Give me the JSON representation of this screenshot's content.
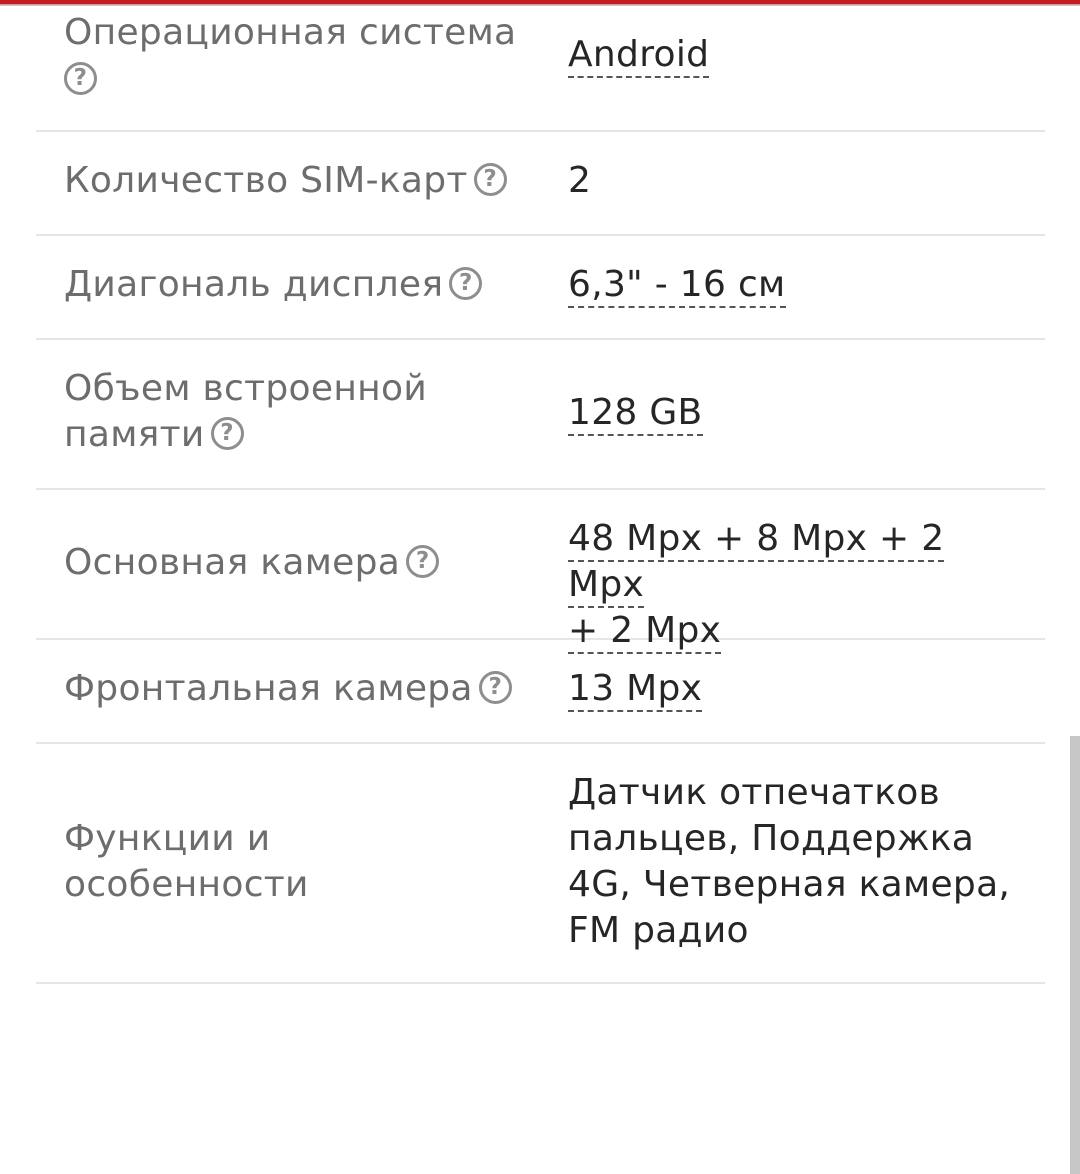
{
  "specs": [
    {
      "label": "Операционная система",
      "value": "Android",
      "help": "?"
    },
    {
      "label": "Количество SIM-карт",
      "value": "2",
      "help": "?"
    },
    {
      "label": "Диагональ дисплея",
      "value": "6,3\" - 16 см",
      "help": "?"
    },
    {
      "label_line1": "Объем встроенной",
      "label_line2": "памяти",
      "value": "128 GB",
      "help": "?"
    },
    {
      "label": "Основная камера",
      "value_line1": "48 Mpx + 8 Mpx + 2 Mpx",
      "value_line2": "+ 2 Mpx",
      "help": "?"
    },
    {
      "label": "Фронтальная камера",
      "value": "13 Mpx",
      "help": "?"
    },
    {
      "label_line1": "Функции и",
      "label_line2": "особенности",
      "value_lines": [
        "Датчик отпечатков",
        "пальцев, Поддержка",
        "4G, Четверная камера,",
        "FM радио"
      ]
    }
  ],
  "colors": {
    "accent": "#c41a22",
    "label_text": "#6d6d6d",
    "value_text": "#262626",
    "divider": "#e6e6e6"
  },
  "icons": {
    "help": "question-circle-icon"
  }
}
